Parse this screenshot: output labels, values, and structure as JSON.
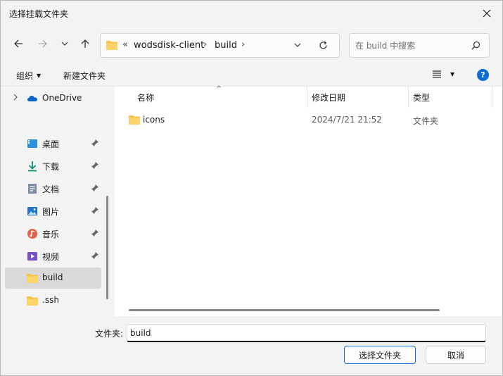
{
  "window": {
    "title": "选择挂载文件夹"
  },
  "address": {
    "overflow": "«",
    "crumbs": [
      "wodsdisk-client",
      "build"
    ]
  },
  "search": {
    "placeholder": "在 build 中搜索"
  },
  "command_bar": {
    "organize": "组织",
    "new_folder": "新建文件夹"
  },
  "sidebar": {
    "items": [
      {
        "label": "OneDrive",
        "icon": "onedrive-icon"
      },
      {
        "label": "桌面",
        "icon": "desktop-icon",
        "pinned": true
      },
      {
        "label": "下载",
        "icon": "download-icon",
        "pinned": true
      },
      {
        "label": "文档",
        "icon": "document-icon",
        "pinned": true
      },
      {
        "label": "图片",
        "icon": "picture-icon",
        "pinned": true
      },
      {
        "label": "音乐",
        "icon": "music-icon",
        "pinned": true
      },
      {
        "label": "视频",
        "icon": "video-icon",
        "pinned": true
      },
      {
        "label": "build",
        "icon": "folder-icon",
        "selected": true
      },
      {
        "label": ".ssh",
        "icon": "folder-icon"
      }
    ]
  },
  "columns": {
    "name": "名称",
    "date": "修改日期",
    "type": "类型"
  },
  "files": [
    {
      "name": "icons",
      "date": "2024/7/21 21:52",
      "type": "文件夹"
    }
  ],
  "footer": {
    "folder_label": "文件夹:",
    "folder_value": "build",
    "select_button": "选择文件夹",
    "cancel_button": "取消"
  },
  "colors": {
    "accent": "#0b6cd4",
    "folder": "#f6c244",
    "selection": "#d9d9d9"
  }
}
